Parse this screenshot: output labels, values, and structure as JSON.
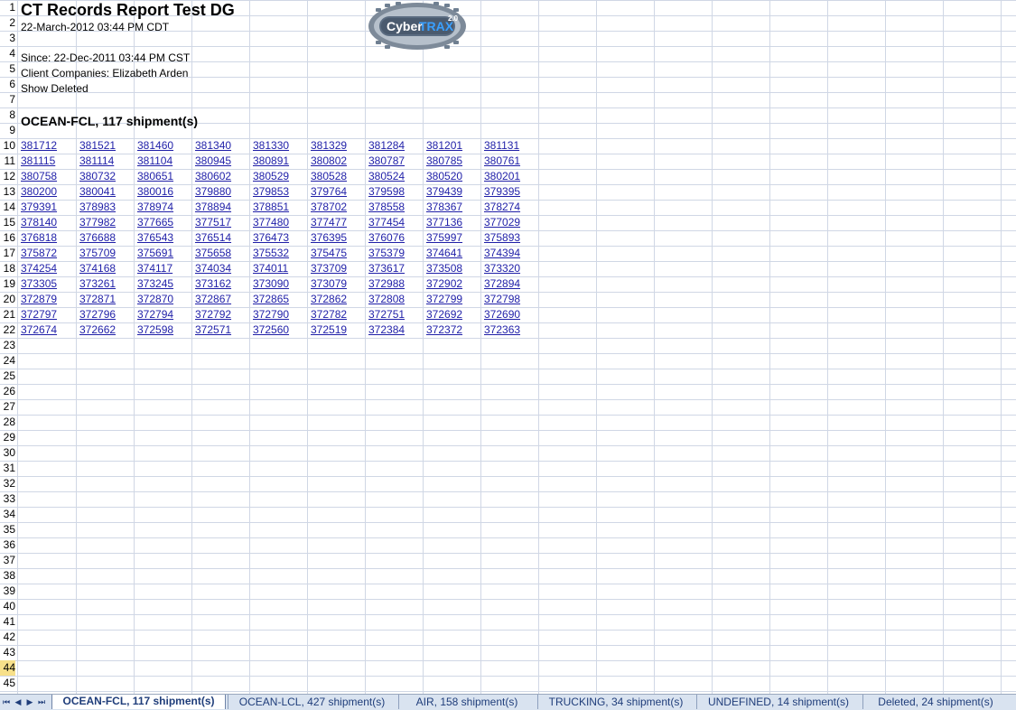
{
  "report": {
    "title": "CT Records Report Test DG",
    "timestamp": "22-March-2012 03:44 PM CDT",
    "since": "Since: 22-Dec-2011 03:44 PM CST",
    "client_companies": "Client Companies: Elizabeth Arden",
    "show_deleted": "Show Deleted",
    "section_heading": "OCEAN-FCL, 117 shipment(s)"
  },
  "logo": {
    "brand_left": "Cyber",
    "brand_right": "TRAX",
    "version": "2.0"
  },
  "row_numbers": [
    "1",
    "2",
    "3",
    "4",
    "5",
    "6",
    "7",
    "8",
    "9",
    "10",
    "11",
    "12",
    "13",
    "14",
    "15",
    "16",
    "17",
    "18",
    "19",
    "20",
    "21",
    "22",
    "23",
    "24",
    "25",
    "26",
    "27",
    "28",
    "29",
    "30",
    "31",
    "32",
    "33",
    "34",
    "35",
    "36",
    "37",
    "38",
    "39",
    "40",
    "41",
    "42",
    "43",
    "44",
    "45"
  ],
  "active_row": "44",
  "shipment_rows": [
    [
      "381712",
      "381521",
      "381460",
      "381340",
      "381330",
      "381329",
      "381284",
      "381201",
      "381131"
    ],
    [
      "381115",
      "381114",
      "381104",
      "380945",
      "380891",
      "380802",
      "380787",
      "380785",
      "380761"
    ],
    [
      "380758",
      "380732",
      "380651",
      "380602",
      "380529",
      "380528",
      "380524",
      "380520",
      "380201"
    ],
    [
      "380200",
      "380041",
      "380016",
      "379880",
      "379853",
      "379764",
      "379598",
      "379439",
      "379395"
    ],
    [
      "379391",
      "378983",
      "378974",
      "378894",
      "378851",
      "378702",
      "378558",
      "378367",
      "378274"
    ],
    [
      "378140",
      "377982",
      "377665",
      "377517",
      "377480",
      "377477",
      "377454",
      "377136",
      "377029"
    ],
    [
      "376818",
      "376688",
      "376543",
      "376514",
      "376473",
      "376395",
      "376076",
      "375997",
      "375893"
    ],
    [
      "375872",
      "375709",
      "375691",
      "375658",
      "375532",
      "375475",
      "375379",
      "374641",
      "374394"
    ],
    [
      "374254",
      "374168",
      "374117",
      "374034",
      "374011",
      "373709",
      "373617",
      "373508",
      "373320"
    ],
    [
      "373305",
      "373261",
      "373245",
      "373162",
      "373090",
      "373079",
      "372988",
      "372902",
      "372894"
    ],
    [
      "372879",
      "372871",
      "372870",
      "372867",
      "372865",
      "372862",
      "372808",
      "372799",
      "372798"
    ],
    [
      "372797",
      "372796",
      "372794",
      "372792",
      "372790",
      "372782",
      "372751",
      "372692",
      "372690"
    ],
    [
      "372674",
      "372662",
      "372598",
      "372571",
      "372560",
      "372519",
      "372384",
      "372372",
      "372363"
    ]
  ],
  "sheet_tabs": [
    {
      "label": "OCEAN-FCL, 117 shipment(s)",
      "active": true
    },
    {
      "label": "OCEAN-LCL, 427 shipment(s)",
      "active": false
    },
    {
      "label": "AIR, 158 shipment(s)",
      "active": false
    },
    {
      "label": "TRUCKING, 34 shipment(s)",
      "active": false
    },
    {
      "label": "UNDEFINED, 14 shipment(s)",
      "active": false
    },
    {
      "label": "Deleted, 24 shipment(s)",
      "active": false
    }
  ],
  "colors": {
    "link": "#1f1fa8",
    "gridline": "#d0d7e5",
    "active_row_highlight": "#f7e08a",
    "tabbar": "#d9e3f0",
    "logo_blue": "#1d63b8",
    "logo_ring": "#6f7f91"
  },
  "icons": [
    "first-sheet-icon",
    "prev-sheet-icon",
    "next-sheet-icon",
    "last-sheet-icon"
  ]
}
